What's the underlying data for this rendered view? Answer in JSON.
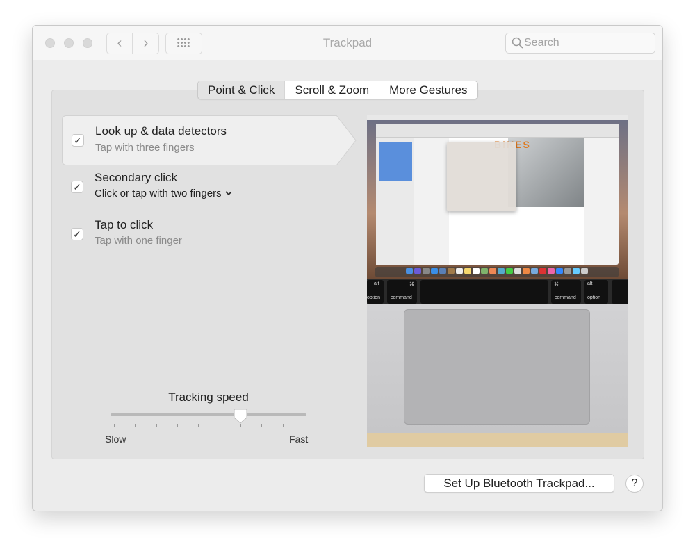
{
  "window": {
    "title": "Trackpad"
  },
  "toolbar": {
    "back_icon": "chevron-left-icon",
    "forward_icon": "chevron-right-icon",
    "grid_icon": "show-all-grid-icon",
    "search_placeholder": "Search"
  },
  "tabs": [
    {
      "label": "Point & Click",
      "selected": true
    },
    {
      "label": "Scroll & Zoom",
      "selected": false
    },
    {
      "label": "More Gestures",
      "selected": false
    }
  ],
  "options": [
    {
      "title": "Look up & data detectors",
      "subtitle": "Tap with three fingers",
      "checked": true,
      "selected": true
    },
    {
      "title": "Secondary click",
      "subtitle": "Click or tap with two fingers",
      "checked": true,
      "has_dropdown": true
    },
    {
      "title": "Tap to click",
      "subtitle": "Tap with one finger",
      "checked": true
    }
  ],
  "tracking": {
    "label": "Tracking speed",
    "min_label": "Slow",
    "max_label": "Fast",
    "ticks": 10,
    "value_fraction": 0.667
  },
  "preview": {
    "keys": {
      "alt": "alt",
      "option": "option",
      "command": "command",
      "cmd_symbol": "⌘"
    }
  },
  "footer": {
    "bluetooth_button": "Set Up Bluetooth Trackpad...",
    "help_button": "?"
  }
}
